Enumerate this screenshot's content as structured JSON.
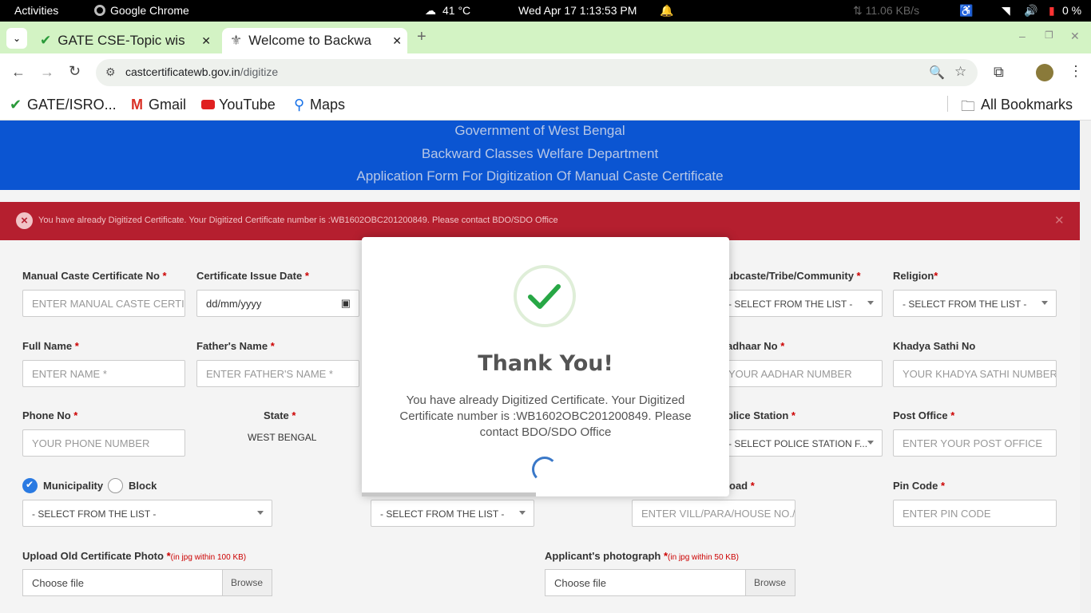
{
  "os": {
    "activities": "Activities",
    "app": "Google Chrome",
    "weather": "41 °C",
    "clock": "Wed Apr 17   1:13:53 PM",
    "net_speed": "11.06 KB/s",
    "battery": "0 %"
  },
  "tabs": [
    {
      "title": "GATE CSE-Topic wis"
    },
    {
      "title": "Welcome to Backwa"
    }
  ],
  "browser": {
    "url_host": "castcertificatewb.gov.in",
    "url_path": "/digitize"
  },
  "bookmarks": {
    "items": [
      "GATE/ISRO...",
      "Gmail",
      "YouTube",
      "Maps"
    ],
    "all": "All Bookmarks"
  },
  "banner": {
    "line1": "Government of West Bengal",
    "line2": "Backward Classes Welfare Department",
    "line3": "Application Form For Digitization Of Manual Caste Certificate"
  },
  "alert": {
    "message": "You have already Digitized Certificate. Your Digitized Certificate number is :WB1602OBC201200849. Please contact BDO/SDO Office"
  },
  "form": {
    "manual_no_label": "Manual Caste Certificate No ",
    "manual_no_placeholder": "ENTER MANUAL CASTE CERTIF",
    "issue_date_label": "Certificate Issue Date ",
    "issue_date_value": "dd/mm/yyyy",
    "subcaste_label": "ubcaste/Tribe/Community ",
    "subcaste_value": "- SELECT FROM THE LIST -",
    "religion_label": "Religion",
    "religion_value": "- SELECT FROM THE LIST -",
    "fullname_label": "Full Name ",
    "fullname_placeholder": "ENTER NAME *",
    "father_label": "Father's Name ",
    "father_placeholder": "ENTER FATHER'S NAME *",
    "aadhaar_label": "adhaar No ",
    "aadhaar_placeholder": "YOUR AADHAR NUMBER",
    "khadya_label": "Khadya Sathi No",
    "khadya_placeholder": "YOUR KHADYA SATHI NUMBER",
    "phone_label": "Phone No ",
    "phone_placeholder": "YOUR PHONE NUMBER",
    "state_label": "State ",
    "state_value": "WEST BENGAL",
    "police_label": "olice Station ",
    "police_value": "- SELECT POLICE STATION F...",
    "postoffice_label": "Post Office ",
    "postoffice_placeholder": "ENTER YOUR POST OFFICE",
    "municipality_label": "Municipality",
    "block_label": "Block",
    "area_select_value": "- SELECT FROM THE LIST -",
    "ward_select_value": "- SELECT FROM THE LIST -",
    "road_label": "oad ",
    "road_placeholder": "ENTER VILL/PARA/HOUSE NO./",
    "pin_label": "Pin Code ",
    "pin_placeholder": "ENTER PIN CODE",
    "old_photo_label": "Upload Old Certificate Photo ",
    "old_photo_hint": "(in jpg within 100 KB)",
    "applicant_photo_label": "Applicant's photograph ",
    "applicant_photo_hint": "(in jpg within 50 KB)",
    "choose_file": "Choose file",
    "browse": "Browse",
    "required_mark": "*"
  },
  "modal": {
    "title": "Thank You!",
    "message": "You have already Digitized Certificate. Your Digitized Certificate number is :WB1602OBC201200849. Please contact BDO/SDO Office"
  },
  "colors": {
    "banner": "#0b55d2",
    "alert": "#b51f2f",
    "success": "#27a745",
    "tabstrip": "#d3f3c4"
  }
}
